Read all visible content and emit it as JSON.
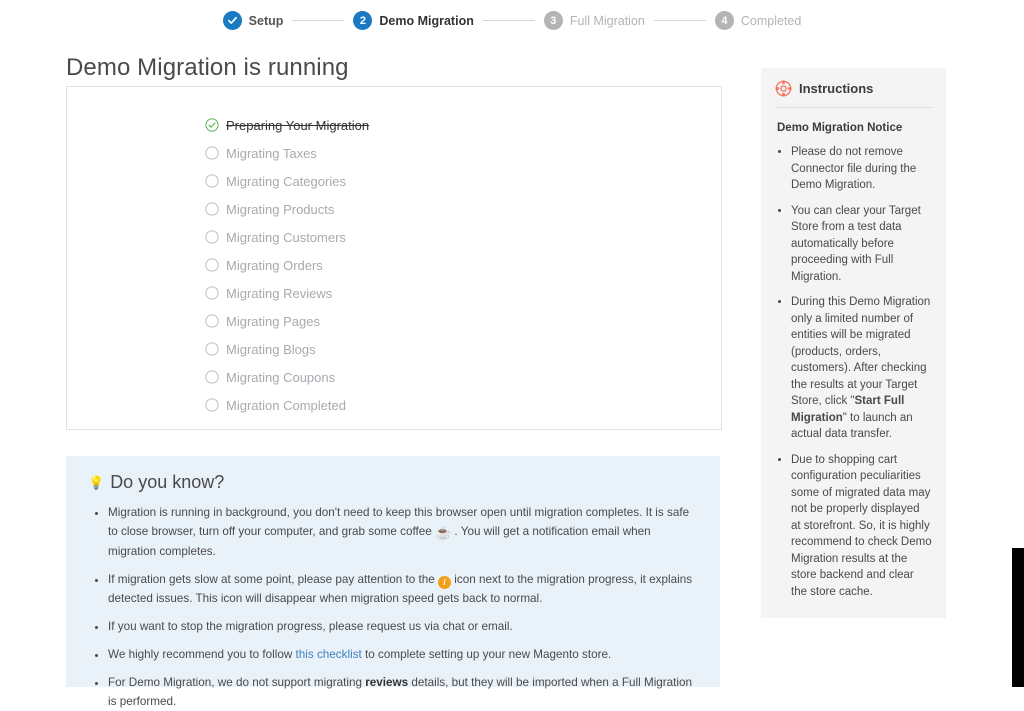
{
  "stepper": {
    "steps": [
      {
        "marker": "check-icon",
        "label": "Setup",
        "state": "done"
      },
      {
        "marker": "2",
        "label": "Demo Migration",
        "state": "active"
      },
      {
        "marker": "3",
        "label": "Full Migration",
        "state": "idle"
      },
      {
        "marker": "4",
        "label": "Completed",
        "state": "idle"
      }
    ],
    "active_color": "#1979c3",
    "idle_color": "#b4b4b4"
  },
  "page": {
    "title": "Demo Migration is running"
  },
  "progress": {
    "items": [
      {
        "label": "Preparing Your Migration",
        "state": "completed"
      },
      {
        "label": "Migrating Taxes",
        "state": "pending"
      },
      {
        "label": "Migrating Categories",
        "state": "pending"
      },
      {
        "label": "Migrating Products",
        "state": "pending"
      },
      {
        "label": "Migrating Customers",
        "state": "pending"
      },
      {
        "label": "Migrating Orders",
        "state": "pending"
      },
      {
        "label": "Migrating Reviews",
        "state": "pending"
      },
      {
        "label": "Migrating Pages",
        "state": "pending"
      },
      {
        "label": "Migrating Blogs",
        "state": "pending"
      },
      {
        "label": "Migrating Coupons",
        "state": "pending"
      },
      {
        "label": "Migration Completed",
        "state": "pending"
      }
    ],
    "completed_color": "#5cb85c",
    "pending_color": "#c2c2c9"
  },
  "instructions": {
    "icon": "lifebuoy-icon",
    "icon_color": "#f4705a",
    "title": "Instructions",
    "subtitle": "Demo Migration Notice",
    "bullets": [
      "Please do not remove Connector file during the Demo Migration.",
      "You can clear your Target Store from a test data automatically before proceeding with Full Migration.",
      "During this Demo Migration only a limited number of entities will be migrated (products, orders, customers). After checking the results at your Target Store, click \"Start Full Migration\" to launch an actual data transfer.",
      "Due to shopping cart configuration peculiarities some of migrated data may not be properly displayed at storefront. So, it is highly recommend to check Demo Migration results at the store backend and clear the store cache."
    ],
    "bullet3_emphasis": "Start Full Migration"
  },
  "did_you_know": {
    "icon": "lightbulb-icon",
    "title": "Do you know?",
    "bullets": [
      {
        "part1": "Migration is running in background, you don't need to keep this browser open until migration completes. It is safe to close browser, turn off your computer, and grab some coffee ",
        "emoji": "☕",
        "part2": " . You will get a notification email when migration completes."
      },
      {
        "part1": "If migration gets slow at some point, please pay attention to the ",
        "icon": "info-icon",
        "icon_glyph": "i",
        "part2": " icon next to the migration progress, it explains detected issues. This icon will disappear when migration speed gets back to normal."
      },
      {
        "text": "If you want to stop the migration progress, please request us via chat or email."
      },
      {
        "part1": "We highly recommend you to follow ",
        "link": "this checklist",
        "part2": " to complete setting up your new Magento store."
      },
      {
        "part1": "For Demo Migration, we do not support migrating ",
        "bold": "reviews",
        "part2": " details, but they will be imported when a Full Migration is performed."
      }
    ],
    "link_color": "#3f7fbf",
    "background": "#eaf2f9"
  }
}
